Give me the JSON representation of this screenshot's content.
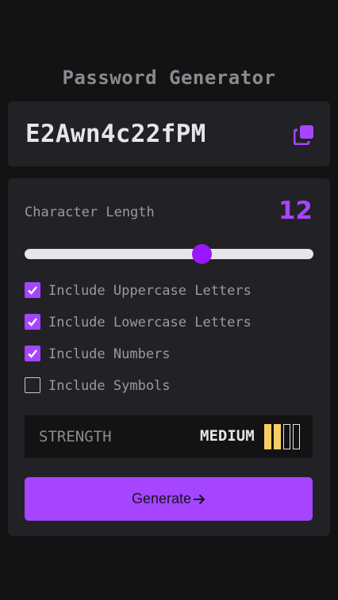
{
  "app": {
    "title": "Password Generator"
  },
  "password": {
    "value": "E2Awn4c22fPM",
    "copy_icon": "copy-icon"
  },
  "length": {
    "label": "Character Length",
    "value": "12",
    "min": 1,
    "max": 20,
    "current": 12
  },
  "options": [
    {
      "label": "Include Uppercase Letters",
      "checked": true
    },
    {
      "label": "Include Lowercase Letters",
      "checked": true
    },
    {
      "label": "Include Numbers",
      "checked": true
    },
    {
      "label": "Include Symbols",
      "checked": false
    }
  ],
  "strength": {
    "label": "STRENGTH",
    "value": "MEDIUM",
    "filled_bars": 2,
    "total_bars": 4
  },
  "generate": {
    "label": "Generate",
    "icon": "arrow-right-icon"
  },
  "colors": {
    "accent": "#a545ff",
    "slider_thumb": "#9a16ff",
    "strength_bar": "#f8cd65",
    "background": "#131313",
    "card": "#222125"
  }
}
